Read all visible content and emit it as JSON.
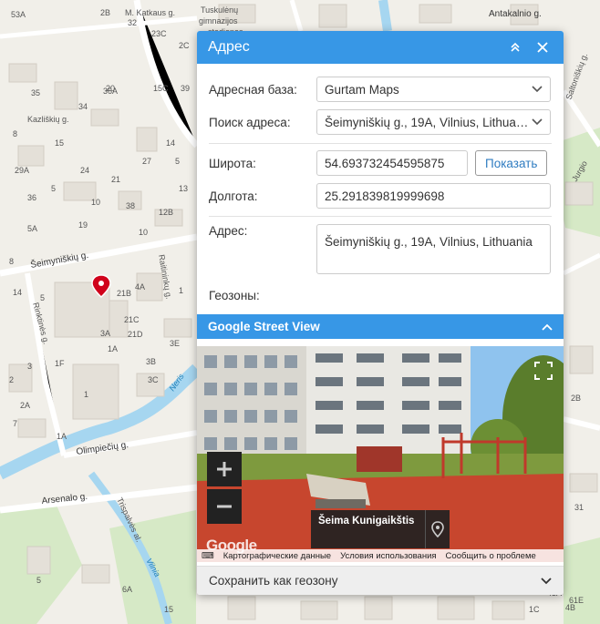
{
  "map": {
    "labels": [
      "53A",
      "2B",
      "M. Katkaus g.",
      "Tuskulėnų gimnazijos stadionas",
      "32",
      "23C",
      "2C",
      "Antakalnio g.",
      "35",
      "20",
      "15C",
      "39",
      "34",
      "36A",
      "Kazliškių g.",
      "29A",
      "8",
      "15",
      "24",
      "21",
      "5",
      "10",
      "27",
      "5",
      "13",
      "36",
      "38",
      "12B",
      "14",
      "19",
      "10",
      "5A",
      "Šeimyniškių g.",
      "Raitininkų g.",
      "8",
      "14",
      "21B",
      "4A",
      "1B",
      "1",
      "5",
      "21C",
      "3A",
      "21D",
      "1F",
      "1A",
      "3B",
      "3C",
      "3E",
      "1",
      "2",
      "2A",
      "3",
      "7",
      "1A",
      "Olimpiečių g.",
      "Arsenalo g.",
      "8",
      "Trispalvės al.",
      "Rinktinės g.",
      "Neris",
      "Vilnia",
      "6A",
      "5",
      "1C",
      "15",
      "4B",
      "43A",
      "61E",
      "31",
      "Jurgio",
      "Saltoniškių g.",
      "2B"
    ],
    "marker": "location-pin"
  },
  "panel": {
    "title": "Адрес",
    "address_base": {
      "label": "Адресная база:",
      "value": "Gurtam Maps"
    },
    "address_search": {
      "label": "Поиск адреса:",
      "value": "Šeimyniškių g., 19A, Vilnius, Lithuania"
    },
    "latitude": {
      "label": "Широта:",
      "value": "54.693732454595875"
    },
    "show_button": "Показать",
    "longitude": {
      "label": "Долгота:",
      "value": "25.291839819999698"
    },
    "address": {
      "label": "Адрес:",
      "value": "Šeimyniškių g., 19A, Vilnius, Lithuania"
    },
    "geozones": {
      "label": "Геозоны:"
    },
    "street_view": {
      "title": "Google Street View",
      "place_name": "Šeima Kunigaikštis",
      "logo": "Google",
      "attribution": [
        "Картографические данные",
        "Условия использования",
        "Сообщить о проблеме"
      ]
    },
    "save_geozone": "Сохранить как геозону"
  },
  "colors": {
    "accent": "#3797e6",
    "marker": "#d0021b"
  }
}
